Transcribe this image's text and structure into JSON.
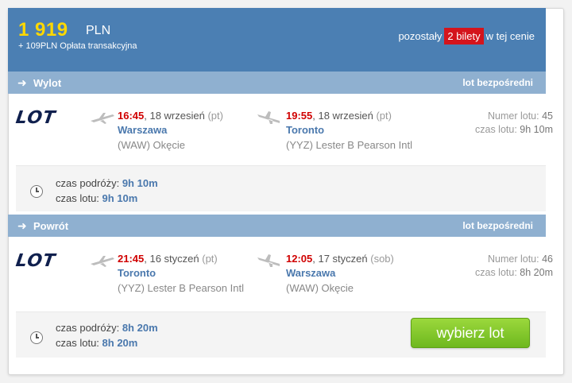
{
  "price": {
    "amount": "1 919",
    "currency": "PLN",
    "fee": "+ 109PLN Opłata transakcyjna"
  },
  "availability": {
    "prefix": "pozostały",
    "badge": "2 bilety",
    "suffix": "w tej cenie"
  },
  "colors": {
    "header": "#4b7fb3",
    "bar": "#8fb0d0",
    "price": "#ffd800",
    "time": "#d00000",
    "city": "#4a78ad",
    "badge": "#d4141c",
    "button": "#7dc42a"
  },
  "outbound": {
    "direction": "Wylot",
    "type": "lot bezpośredni",
    "airline": "LOT",
    "depart": {
      "time": "16:45",
      "date": ", 18 wrzesień",
      "dow": "(pt)",
      "city": "Warszawa",
      "airport": "(WAW) Okęcie"
    },
    "arrive": {
      "time": "19:55",
      "date": ", 18 wrzesień",
      "dow": "(pt)",
      "city": "Toronto",
      "airport": "(YYZ) Lester B Pearson Intl"
    },
    "flight_number_label": "Numer lotu:",
    "flight_number": "45",
    "duration_label": "czas lotu:",
    "duration": "9h 10m",
    "summary": {
      "travel_label": "czas podróży:",
      "travel": "9h 10m",
      "flight_label": "czas lotu:",
      "flight": "9h 10m"
    }
  },
  "return": {
    "direction": "Powrót",
    "type": "lot bezpośredni",
    "airline": "LOT",
    "depart": {
      "time": "21:45",
      "date": ", 16 styczeń",
      "dow": "(pt)",
      "city": "Toronto",
      "airport": "(YYZ) Lester B Pearson Intl"
    },
    "arrive": {
      "time": "12:05",
      "date": ", 17 styczeń",
      "dow": "(sob)",
      "city": "Warszawa",
      "airport": "(WAW) Okęcie"
    },
    "flight_number_label": "Numer lotu:",
    "flight_number": "46",
    "duration_label": "czas lotu:",
    "duration": "8h 20m",
    "summary": {
      "travel_label": "czas podróży:",
      "travel": "8h 20m",
      "flight_label": "czas lotu:",
      "flight": "8h 20m"
    }
  },
  "icons": {
    "arrow": "arrow-right-icon",
    "plane_depart": "plane-takeoff-icon",
    "plane_arrive": "plane-landing-icon",
    "clock": "clock-icon"
  },
  "button": {
    "select": "wybierz lot"
  }
}
